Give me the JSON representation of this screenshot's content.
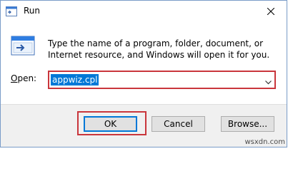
{
  "window": {
    "title": "Run",
    "description": "Type the name of a program, folder, document, or Internet resource, and Windows will open it for you."
  },
  "open": {
    "label_underlined": "O",
    "label_rest": "pen:",
    "value": "appwiz.cpl"
  },
  "buttons": {
    "ok": "OK",
    "cancel": "Cancel",
    "browse": "Browse..."
  },
  "watermark": "wsxdn.com",
  "icons": {
    "app": "run-app-icon",
    "close": "close-icon",
    "run": "run-dialog-icon",
    "dropdown": "chevron-down-icon"
  },
  "colors": {
    "highlight": "#c9363c",
    "selection": "#0078d7",
    "footer": "#f0f0f0"
  }
}
